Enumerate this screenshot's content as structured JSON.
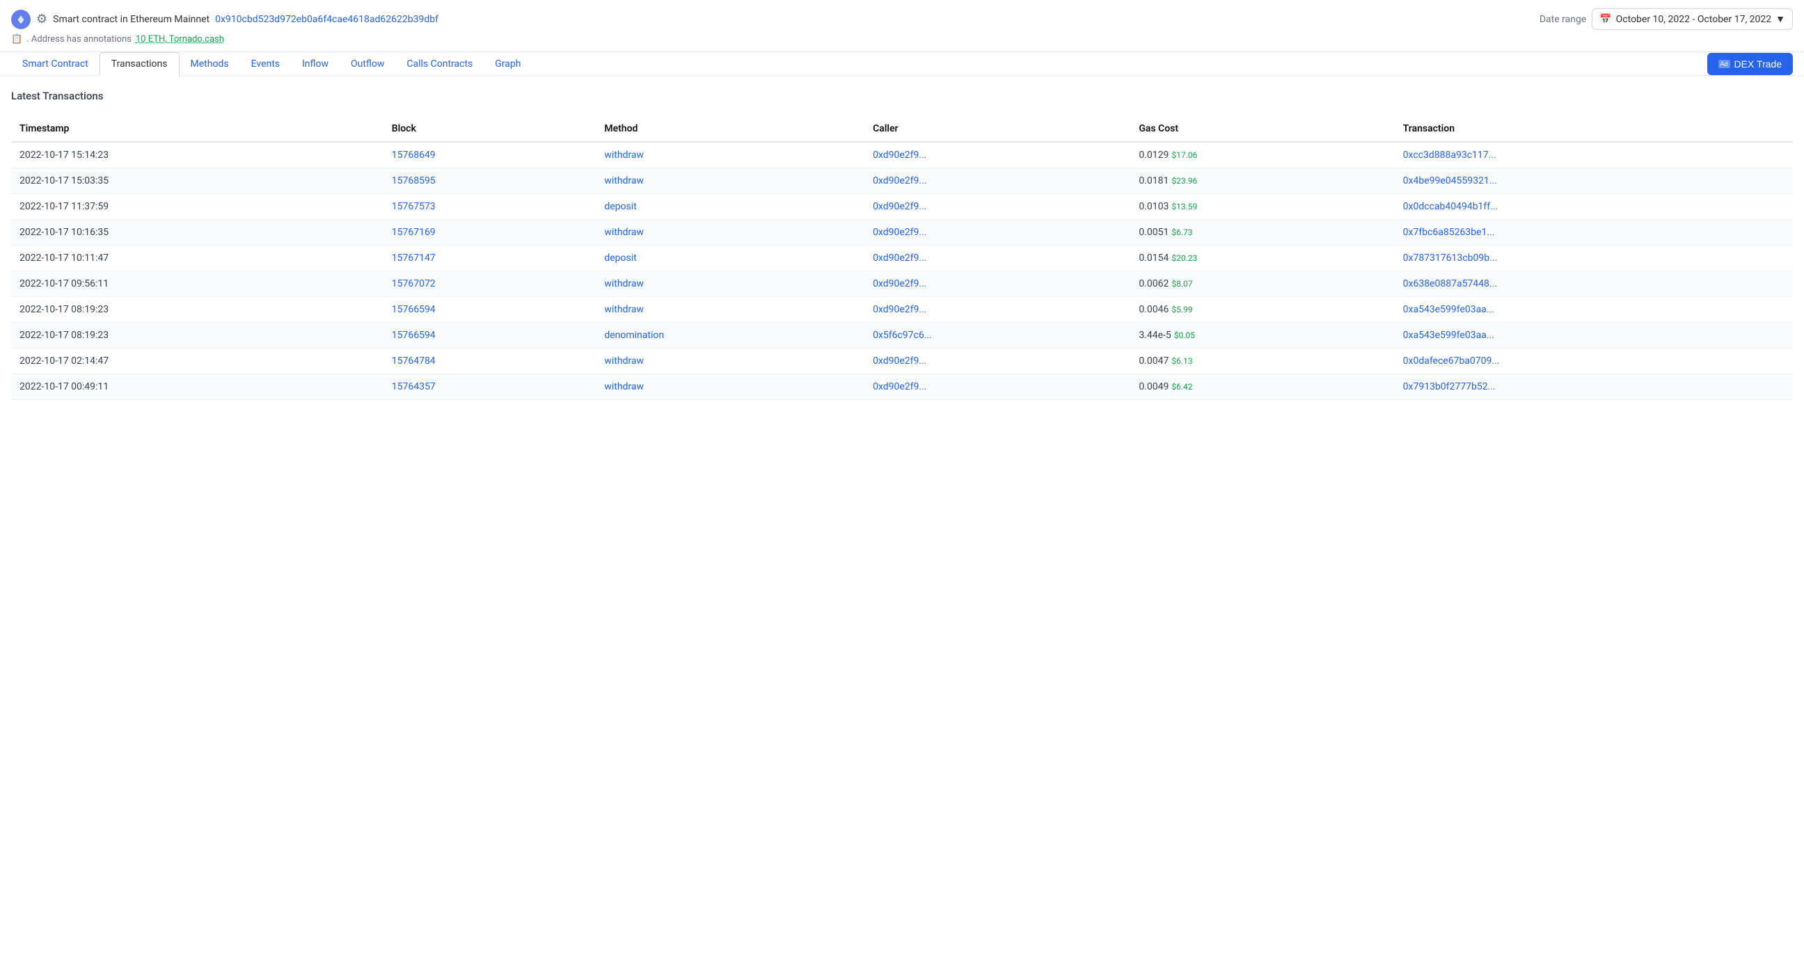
{
  "header": {
    "contract_prefix": "Smart contract in Ethereum Mainnet",
    "contract_address": "0x910cbd523d972eb0a6f4cae4618ad62622b39dbf",
    "annotations_prefix": ". Address has annotations",
    "annotations_link": "10 ETH, Tornado.cash",
    "date_range_label": "Date range",
    "date_range_value": "October 10, 2022 - October 17, 2022"
  },
  "tabs": [
    {
      "id": "smart-contract",
      "label": "Smart Contract",
      "active": false
    },
    {
      "id": "transactions",
      "label": "Transactions",
      "active": true
    },
    {
      "id": "methods",
      "label": "Methods",
      "active": false
    },
    {
      "id": "events",
      "label": "Events",
      "active": false
    },
    {
      "id": "inflow",
      "label": "Inflow",
      "active": false
    },
    {
      "id": "outflow",
      "label": "Outflow",
      "active": false
    },
    {
      "id": "calls-contracts",
      "label": "Calls Contracts",
      "active": false
    },
    {
      "id": "graph",
      "label": "Graph",
      "active": false
    }
  ],
  "dex_trade_label": "DEX Trade",
  "section_title": "Latest Transactions",
  "table": {
    "columns": [
      "Timestamp",
      "Block",
      "Method",
      "Caller",
      "Gas Cost",
      "Transaction"
    ],
    "rows": [
      {
        "timestamp": "2022-10-17 15:14:23",
        "block": "15768649",
        "method": "withdraw",
        "caller": "0xd90e2f9...",
        "gas_cost": "0.0129",
        "gas_cost_usd": "$17.06",
        "transaction": "0xcc3d888a93c117..."
      },
      {
        "timestamp": "2022-10-17 15:03:35",
        "block": "15768595",
        "method": "withdraw",
        "caller": "0xd90e2f9...",
        "gas_cost": "0.0181",
        "gas_cost_usd": "$23.96",
        "transaction": "0x4be99e04559321..."
      },
      {
        "timestamp": "2022-10-17 11:37:59",
        "block": "15767573",
        "method": "deposit",
        "caller": "0xd90e2f9...",
        "gas_cost": "0.0103",
        "gas_cost_usd": "$13.59",
        "transaction": "0x0dccab40494b1ff..."
      },
      {
        "timestamp": "2022-10-17 10:16:35",
        "block": "15767169",
        "method": "withdraw",
        "caller": "0xd90e2f9...",
        "gas_cost": "0.0051",
        "gas_cost_usd": "$6.73",
        "transaction": "0x7fbc6a85263be1..."
      },
      {
        "timestamp": "2022-10-17 10:11:47",
        "block": "15767147",
        "method": "deposit",
        "caller": "0xd90e2f9...",
        "gas_cost": "0.0154",
        "gas_cost_usd": "$20.23",
        "transaction": "0x787317613cb09b..."
      },
      {
        "timestamp": "2022-10-17 09:56:11",
        "block": "15767072",
        "method": "withdraw",
        "caller": "0xd90e2f9...",
        "gas_cost": "0.0062",
        "gas_cost_usd": "$8.07",
        "transaction": "0x638e0887a57448..."
      },
      {
        "timestamp": "2022-10-17 08:19:23",
        "block": "15766594",
        "method": "withdraw",
        "caller": "0xd90e2f9...",
        "gas_cost": "0.0046",
        "gas_cost_usd": "$5.99",
        "transaction": "0xa543e599fe03aa..."
      },
      {
        "timestamp": "2022-10-17 08:19:23",
        "block": "15766594",
        "method": "denomination",
        "caller": "0x5f6c97c6...",
        "gas_cost": "3.44e-5",
        "gas_cost_usd": "$0.05",
        "transaction": "0xa543e599fe03aa..."
      },
      {
        "timestamp": "2022-10-17 02:14:47",
        "block": "15764784",
        "method": "withdraw",
        "caller": "0xd90e2f9...",
        "gas_cost": "0.0047",
        "gas_cost_usd": "$6.13",
        "transaction": "0x0dafece67ba0709..."
      },
      {
        "timestamp": "2022-10-17 00:49:11",
        "block": "15764357",
        "method": "withdraw",
        "caller": "0xd90e2f9...",
        "gas_cost": "0.0049",
        "gas_cost_usd": "$6.42",
        "transaction": "0x7913b0f2777b52..."
      }
    ]
  }
}
